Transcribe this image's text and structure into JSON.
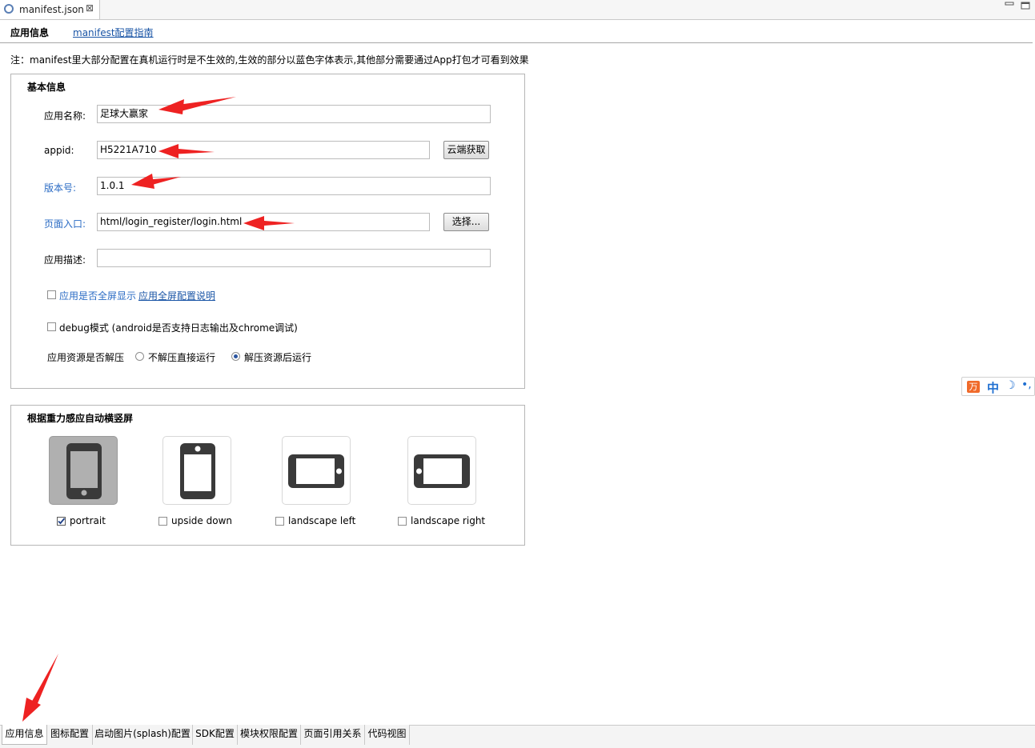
{
  "editor_tab": {
    "label": "manifest.json",
    "close": "⊠"
  },
  "header": {
    "title": "应用信息",
    "guide_link": "manifest配置指南"
  },
  "note": "注：manifest里大部分配置在真机运行时是不生效的,生效的部分以蓝色字体表示,其他部分需要通过App打包才可看到效果",
  "basic": {
    "title": "基本信息",
    "app_name_label": "应用名称:",
    "app_name_value": "足球大赢家",
    "appid_label": "appid:",
    "appid_value": "H5221A710",
    "cloud_button": "云端获取",
    "version_label": "版本号:",
    "version_value": "1.0.1",
    "entry_label": "页面入口:",
    "entry_value": "html/login_register/login.html",
    "select_button": "选择...",
    "desc_label": "应用描述:",
    "desc_value": "",
    "fullscreen_label": "应用是否全屏显示",
    "fullscreen_link": "应用全屏配置说明",
    "fullscreen_checked": false,
    "debug_label": "debug模式 (android是否支持日志输出及chrome调试)",
    "debug_checked": false,
    "unzip_label": "应用资源是否解压",
    "unzip_option_1": "不解压直接运行",
    "unzip_option_2": "解压资源后运行",
    "unzip_selected": "解压资源后运行"
  },
  "orientation": {
    "title": "根据重力感应自动横竖屏",
    "options": [
      {
        "label": "portrait",
        "checked": true,
        "icon": "phone-portrait-icon"
      },
      {
        "label": "upside down",
        "checked": false,
        "icon": "phone-upside-down-icon"
      },
      {
        "label": "landscape left",
        "checked": false,
        "icon": "phone-landscape-left-icon"
      },
      {
        "label": "landscape right",
        "checked": false,
        "icon": "phone-landscape-right-icon"
      }
    ]
  },
  "bottom_tabs": [
    "应用信息",
    "图标配置",
    "启动图片(splash)配置",
    "SDK配置",
    "模块权限配置",
    "页面引用关系",
    "代码视图"
  ],
  "active_bottom_tab": "应用信息",
  "ime": {
    "logo": "万",
    "mode": "中",
    "moon": "☽",
    "punct": "•,"
  },
  "colors": {
    "link": "#1a55a6",
    "real_device_label": "#2a6bc4",
    "annotation_arrow": "#ee2222"
  }
}
